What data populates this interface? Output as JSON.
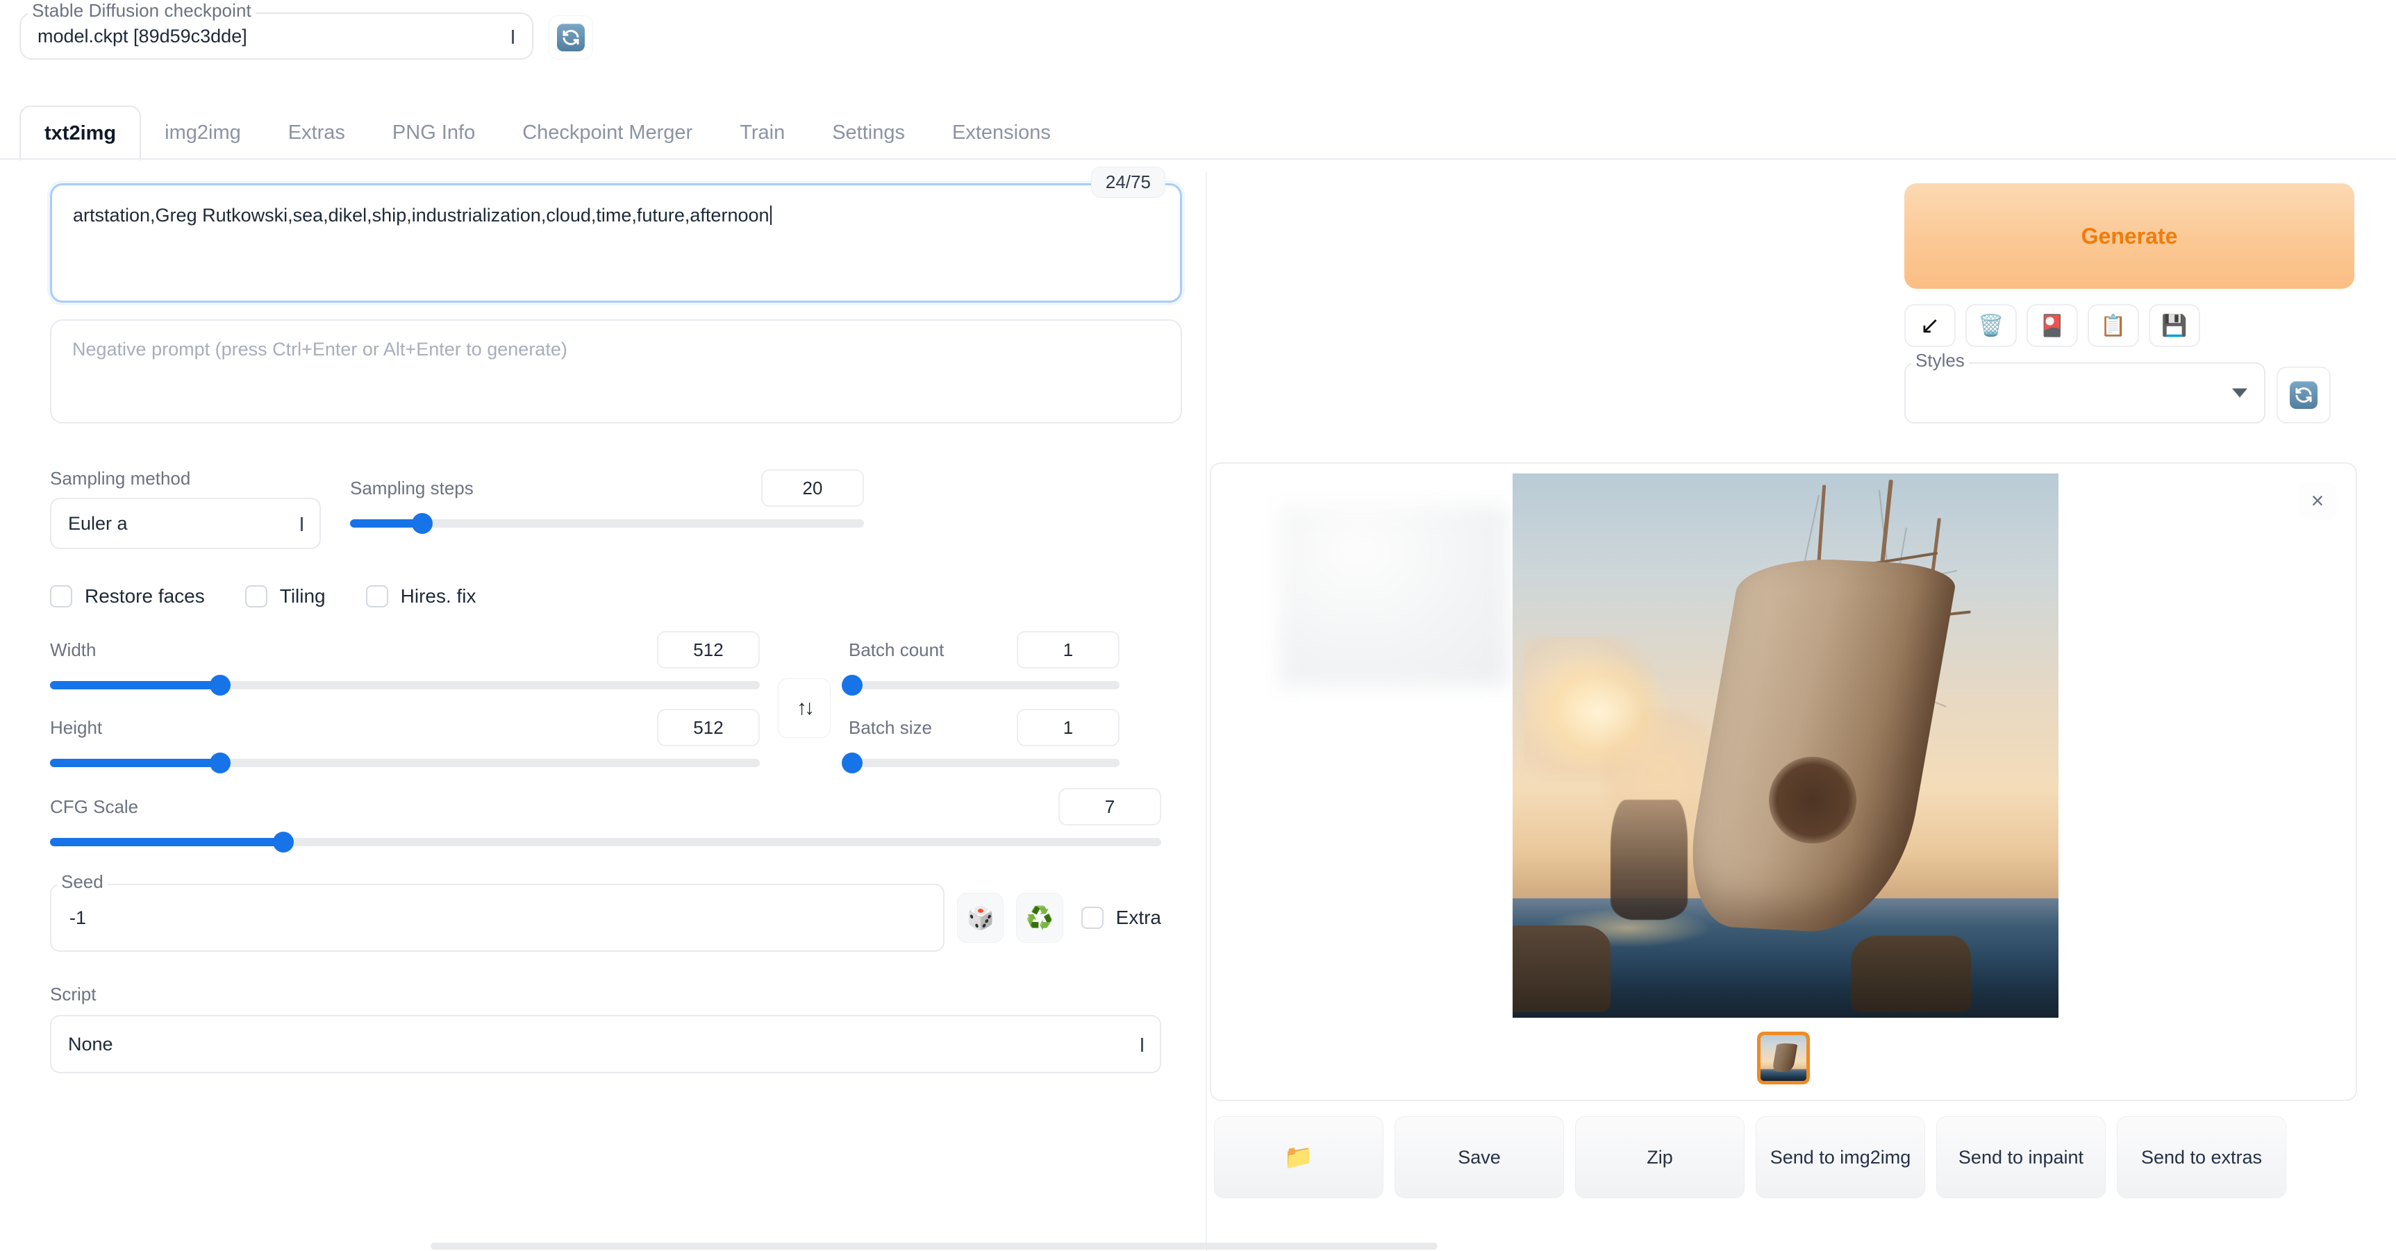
{
  "checkpoint": {
    "legend": "Stable Diffusion checkpoint",
    "value": "model.ckpt [89d59c3dde]",
    "refresh_icon": "refresh-icon"
  },
  "tabs": [
    {
      "label": "txt2img",
      "active": true
    },
    {
      "label": "img2img",
      "active": false
    },
    {
      "label": "Extras",
      "active": false
    },
    {
      "label": "PNG Info",
      "active": false
    },
    {
      "label": "Checkpoint Merger",
      "active": false
    },
    {
      "label": "Train",
      "active": false
    },
    {
      "label": "Settings",
      "active": false
    },
    {
      "label": "Extensions",
      "active": false
    }
  ],
  "prompt": {
    "value": "artstation,Greg Rutkowski,sea,dikel,ship,industrialization,cloud,time,future,afternoon",
    "token_count": "24/75"
  },
  "negative_prompt": {
    "placeholder": "Negative prompt (press Ctrl+Enter or Alt+Enter to generate)",
    "value": ""
  },
  "generate": {
    "label": "Generate",
    "accent_color": "#f07c0c",
    "background_color": "#fbc894"
  },
  "prompt_tools": [
    {
      "name": "restore-progress-icon",
      "glyph": "↙"
    },
    {
      "name": "clear-prompt-icon",
      "glyph": "🗑️"
    },
    {
      "name": "apply-style-icon",
      "glyph": "🎴"
    },
    {
      "name": "paste-icon",
      "glyph": "📋"
    },
    {
      "name": "save-style-icon",
      "glyph": "💾"
    }
  ],
  "styles": {
    "legend": "Styles",
    "value": "",
    "refresh_icon": "refresh-icon"
  },
  "sampling_method": {
    "label": "Sampling method",
    "value": "Euler a"
  },
  "sampling_steps": {
    "label": "Sampling steps",
    "value": "20",
    "percent": 14
  },
  "toggles": [
    {
      "label": "Restore faces",
      "checked": false
    },
    {
      "label": "Tiling",
      "checked": false
    },
    {
      "label": "Hires. fix",
      "checked": false
    }
  ],
  "width": {
    "label": "Width",
    "value": "512",
    "percent": 24
  },
  "height": {
    "label": "Height",
    "value": "512",
    "percent": 24
  },
  "cfg_scale": {
    "label": "CFG Scale",
    "value": "7",
    "percent": 21
  },
  "batch_count": {
    "label": "Batch count",
    "value": "1",
    "percent": 0
  },
  "batch_size": {
    "label": "Batch size",
    "value": "1",
    "percent": 0
  },
  "swap_button": {
    "name": "swap-dimensions-icon",
    "glyph": "↑↓"
  },
  "seed": {
    "legend": "Seed",
    "value": "-1",
    "random_icon": "🎲",
    "recycle_icon": "♻️",
    "extra_label": "Extra",
    "extra_checked": false
  },
  "script": {
    "label": "Script",
    "value": "None"
  },
  "result": {
    "close_label": "×",
    "image_alt": "generated tall ship at sunset on the sea",
    "thumbnail_selected": true
  },
  "bottom_buttons": [
    {
      "label": "📁",
      "name": "open-folder-button",
      "is_icon": true
    },
    {
      "label": "Save",
      "name": "save-button",
      "is_icon": false
    },
    {
      "label": "Zip",
      "name": "zip-button",
      "is_icon": false
    },
    {
      "label": "Send to img2img",
      "name": "send-to-img2img-button",
      "is_icon": false
    },
    {
      "label": "Send to inpaint",
      "name": "send-to-inpaint-button",
      "is_icon": false
    },
    {
      "label": "Send to extras",
      "name": "send-to-extras-button",
      "is_icon": false
    }
  ]
}
